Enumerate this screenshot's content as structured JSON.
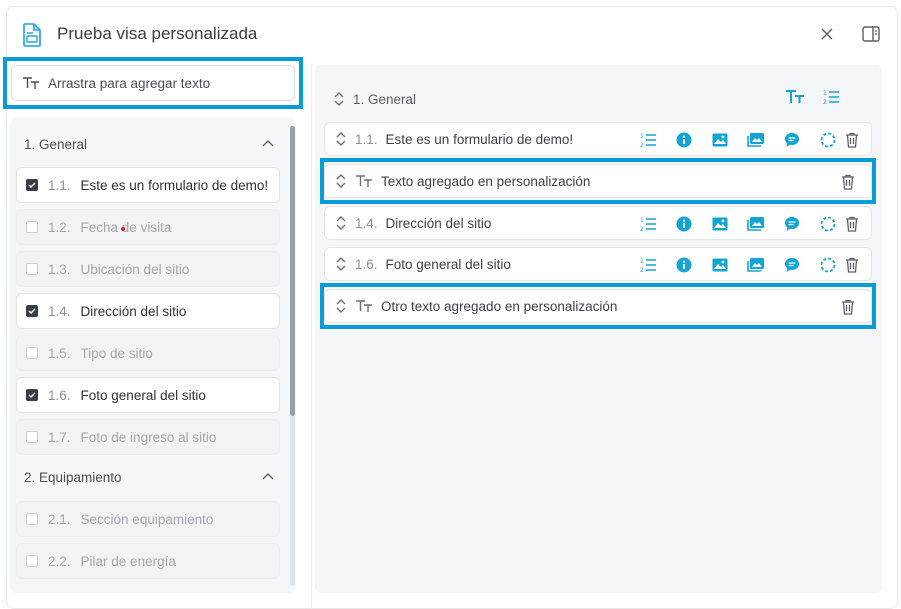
{
  "modal": {
    "title": "Prueba visa personalizada",
    "icons": {
      "doc": "document-icon",
      "close": "close-icon",
      "panel": "side-panel-icon"
    }
  },
  "drag_text": {
    "label": "Arrastra para agregar texto",
    "icon": "text-type-icon"
  },
  "left": {
    "sections": [
      {
        "title": "1. General",
        "items": [
          {
            "num": "1.1.",
            "label": "Este es un formulario de demo!",
            "checked": true
          },
          {
            "num": "1.2.",
            "label": "Fecha de visita",
            "checked": false
          },
          {
            "num": "1.3.",
            "label": "Ubicación del sitio",
            "checked": false
          },
          {
            "num": "1.4.",
            "label": "Dirección del sitio",
            "checked": true
          },
          {
            "num": "1.5.",
            "label": "Tipo de sitio",
            "checked": false
          },
          {
            "num": "1.6.",
            "label": "Foto general del sitio",
            "checked": true
          },
          {
            "num": "1.7.",
            "label": "Foto de ingreso al sitio",
            "checked": false
          }
        ]
      },
      {
        "title": "2. Equipamiento",
        "items": [
          {
            "num": "2.1.",
            "label": "Sección equipamiento",
            "checked": false
          },
          {
            "num": "2.2.",
            "label": "Pilar de energía",
            "checked": false
          }
        ]
      }
    ]
  },
  "right": {
    "section_title": "1. General",
    "rows": [
      {
        "num": "1.1.",
        "label": "Este es un formulario de demo!",
        "type": "question"
      },
      {
        "num": "",
        "label": "Texto agregado en personalización",
        "type": "text"
      },
      {
        "num": "1.4.",
        "label": "Dirección del sitio",
        "type": "question"
      },
      {
        "num": "1.6.",
        "label": "Foto general del sitio",
        "type": "question"
      },
      {
        "num": "",
        "label": "Otro texto agregado en personalización",
        "type": "text"
      }
    ],
    "row_icons": [
      "numbered-list-icon",
      "info-icon",
      "image-icon",
      "gallery-icon",
      "comment-icon",
      "dashed-circle-icon"
    ]
  },
  "colors": {
    "accent": "#0a9bd9",
    "icon_teal": "#12a4d4",
    "highlight": "#0a9bd9"
  }
}
